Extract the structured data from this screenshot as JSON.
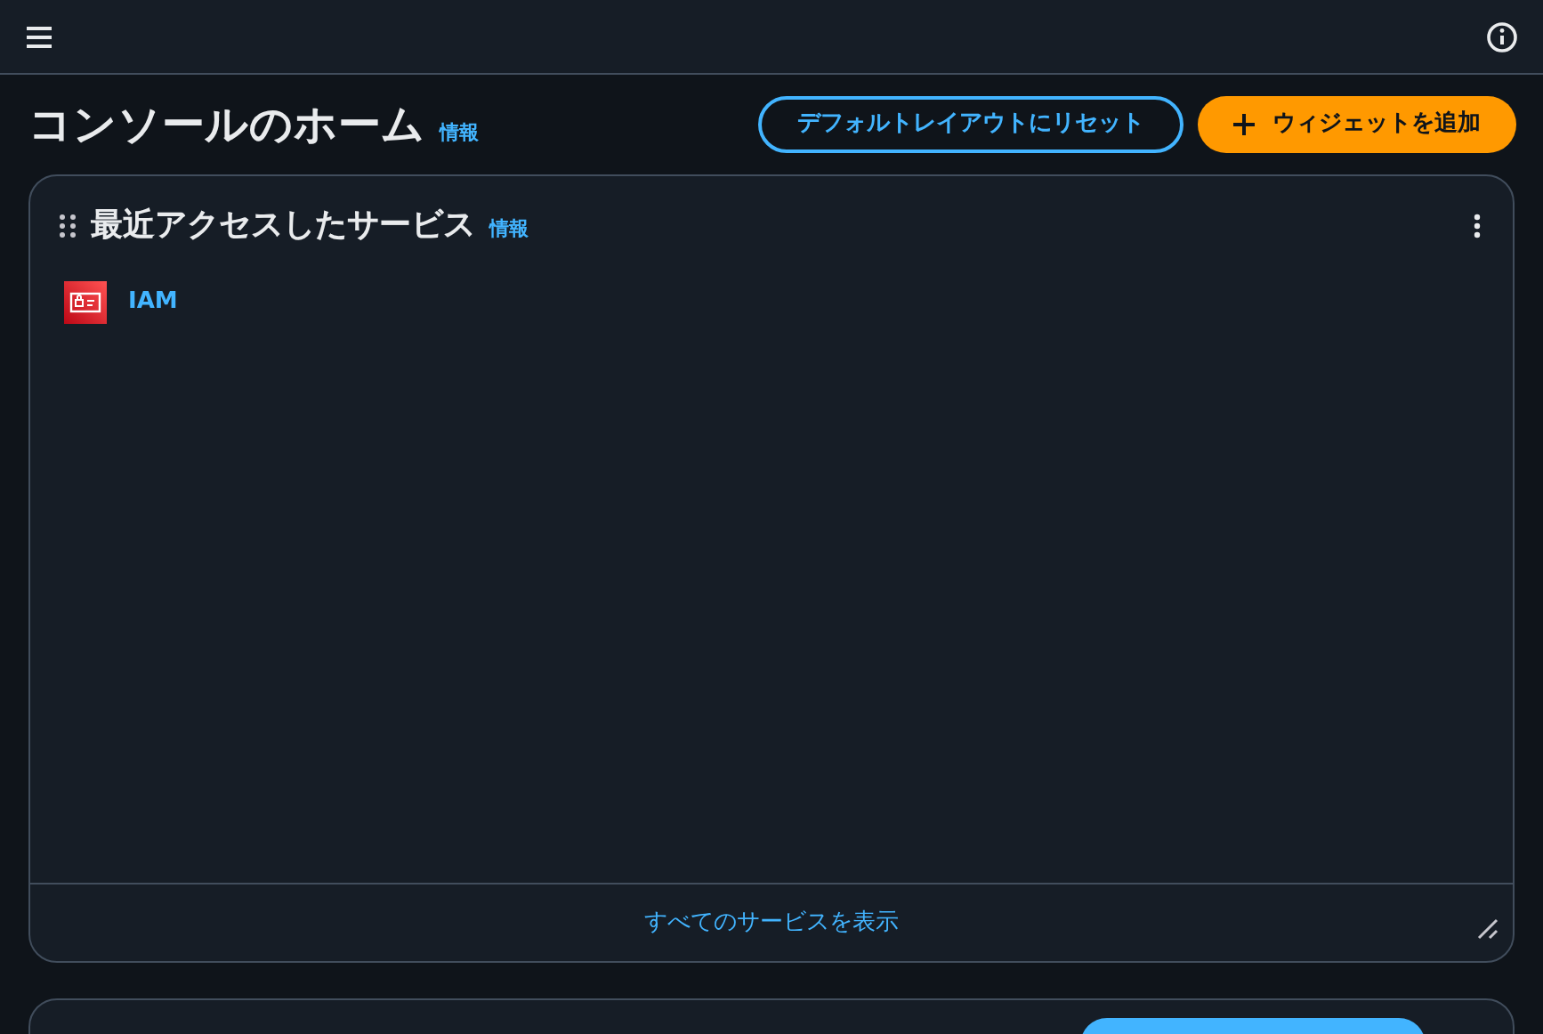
{
  "page": {
    "title": "コンソールのホーム",
    "info_link": "情報"
  },
  "actions": [
    {
      "kind": "outline",
      "label": "デフォルトレイアウトにリセット"
    },
    {
      "kind": "primary",
      "label": "ウィジェットを追加"
    }
  ],
  "widget": {
    "title": "最近アクセスしたサービス",
    "info_link": "情報",
    "services": [
      {
        "name": "IAM"
      }
    ],
    "footer_link": "すべてのサービスを表示"
  }
}
